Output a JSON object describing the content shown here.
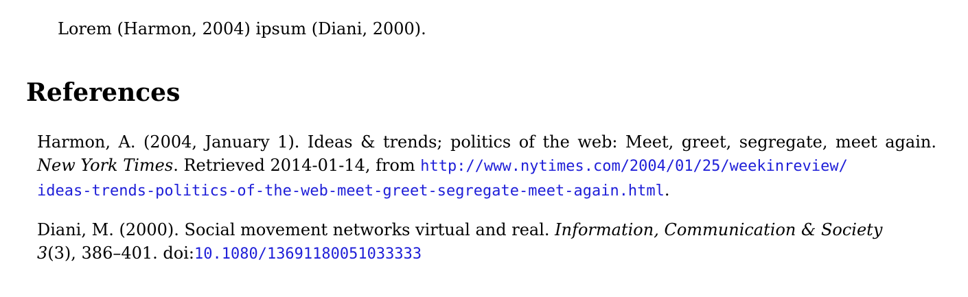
{
  "body": {
    "text": "Lorem (Harmon, 2004) ipsum (Diani, 2000)."
  },
  "references": {
    "heading": "References",
    "items": [
      {
        "line1": "Harmon, A. (2004, January 1). Ideas & trends; politics of the web: Meet, greet, segregate, meet again.",
        "journal": "New York Times",
        "after_journal": ". Retrieved 2014-01-14, from ",
        "url_part1": "http://www.nytimes.com/2004/01/25/weekinreview/",
        "url_part2": "ideas-trends-politics-of-the-web-meet-greet-segregate-meet-again.html",
        "trailing": "."
      },
      {
        "lead": "Diani, M. (2000). Social movement networks virtual and real. ",
        "journal": "Information, Communication & Society",
        "volume": "3",
        "rest": "(3), 386–401. doi:",
        "doi": "10.1080/13691180051033333"
      }
    ]
  },
  "colors": {
    "link": "#1e1ed8",
    "text": "#000000",
    "background": "#ffffff"
  }
}
